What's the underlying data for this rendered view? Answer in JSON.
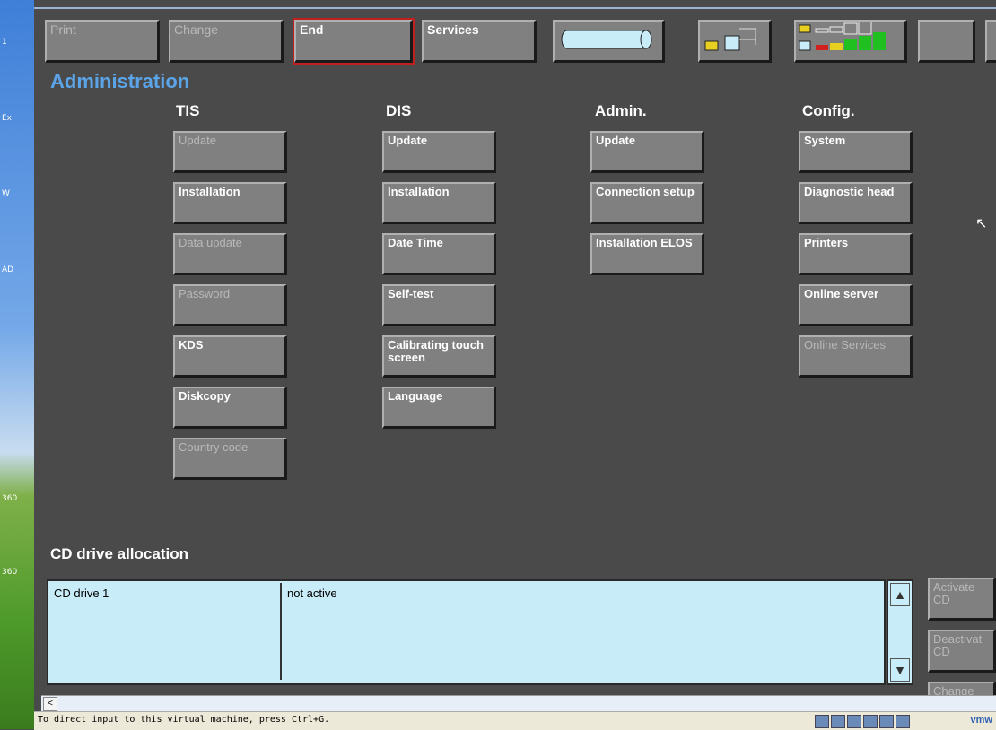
{
  "desktop": {
    "labels": [
      "1",
      "Ex",
      "W",
      "AD",
      "360",
      "360"
    ]
  },
  "toolbar": {
    "print": "Print",
    "change": "Change",
    "end": "End",
    "services": "Services"
  },
  "title": "Administration",
  "columns": {
    "tis": {
      "header": "TIS",
      "buttons": [
        "Update",
        "Installation",
        "Data update",
        "Password",
        "KDS",
        "Diskcopy",
        "Country code"
      ],
      "disabled": [
        true,
        false,
        true,
        true,
        false,
        false,
        true
      ]
    },
    "dis": {
      "header": "DIS",
      "buttons": [
        "Update",
        "Installation",
        "Date Time",
        "Self-test",
        "Calibrating touch screen",
        "Language"
      ]
    },
    "admin": {
      "header": "Admin.",
      "buttons": [
        "Update",
        "Connection setup",
        "Installation ELOS"
      ]
    },
    "config": {
      "header": "Config.",
      "buttons": [
        "System",
        "Diagnostic head",
        "Printers",
        "Online server",
        "Online Services"
      ],
      "disabled": [
        false,
        false,
        false,
        false,
        true
      ]
    }
  },
  "cd": {
    "heading": "CD drive allocation",
    "drive": "CD drive 1",
    "status": "not active",
    "activate": "Activate CD",
    "deactivate": "Deactivat CD",
    "change": "Change"
  },
  "status_bar": {
    "message": "To direct input to this virtual machine, press Ctrl+G.",
    "vm": "vmw"
  },
  "colors": {
    "title": "#5ba4e8",
    "panel": "#4a4a4a",
    "button": "#808080",
    "table": "#c8ecf8"
  }
}
